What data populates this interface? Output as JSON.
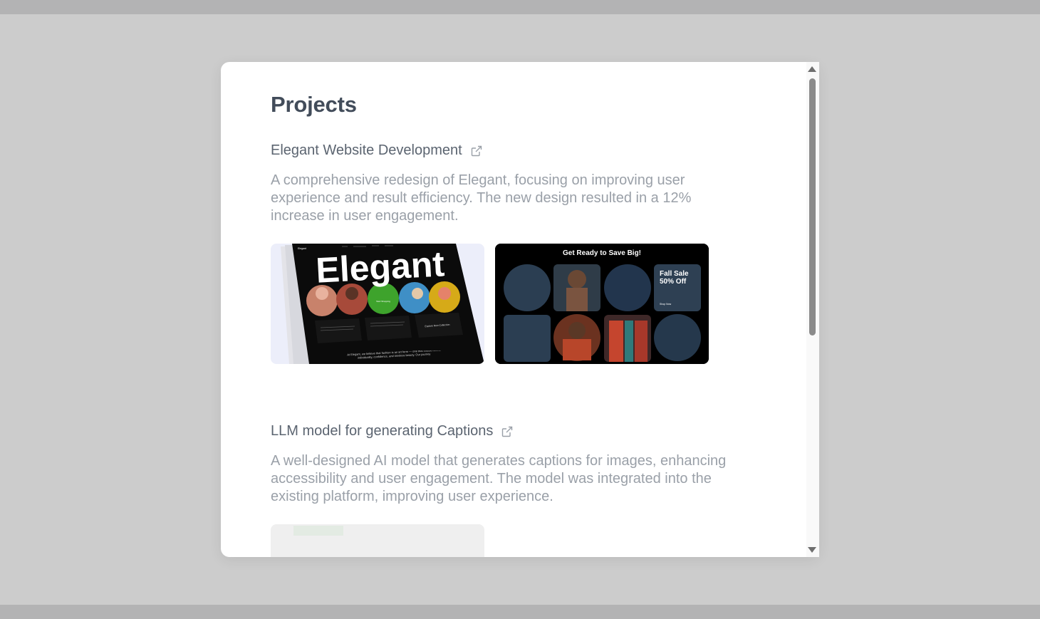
{
  "modal": {
    "heading": "Projects",
    "projects": [
      {
        "title": "Elegant Website Development",
        "description": "A comprehensive redesign of Elegant, focusing on improving user experience and result efficiency. The new design resulted in a 12% increase in user engagement.",
        "thumbnails": [
          {
            "headline": "Elegant",
            "nav_brand": "Elegant",
            "button": "Explore New Collection",
            "center_badge": "Start Shopping",
            "body": "At Elegant, we believe that fashion is an art form — one that should reflect individuality, confidence, and timeless beauty. Our journey"
          },
          {
            "headline": "Get Ready to Save Big!",
            "sale_title": "Fall Sale",
            "sale_off": "50% Off",
            "sale_cta": "Shop Now"
          }
        ]
      },
      {
        "title": "LLM model for generating Captions",
        "description": "A well-designed AI model that generates captions for images, enhancing accessibility and user engagement. The model was integrated into the existing platform, improving user experience."
      }
    ]
  },
  "colors": {
    "page_bg": "#cccccc",
    "heading": "#424c5a",
    "title": "#5b6470",
    "description": "#9aa0a8"
  },
  "icons": {
    "external": "external-link-icon",
    "scroll_up": "scroll-up-arrow-icon",
    "scroll_down": "scroll-down-arrow-icon"
  }
}
